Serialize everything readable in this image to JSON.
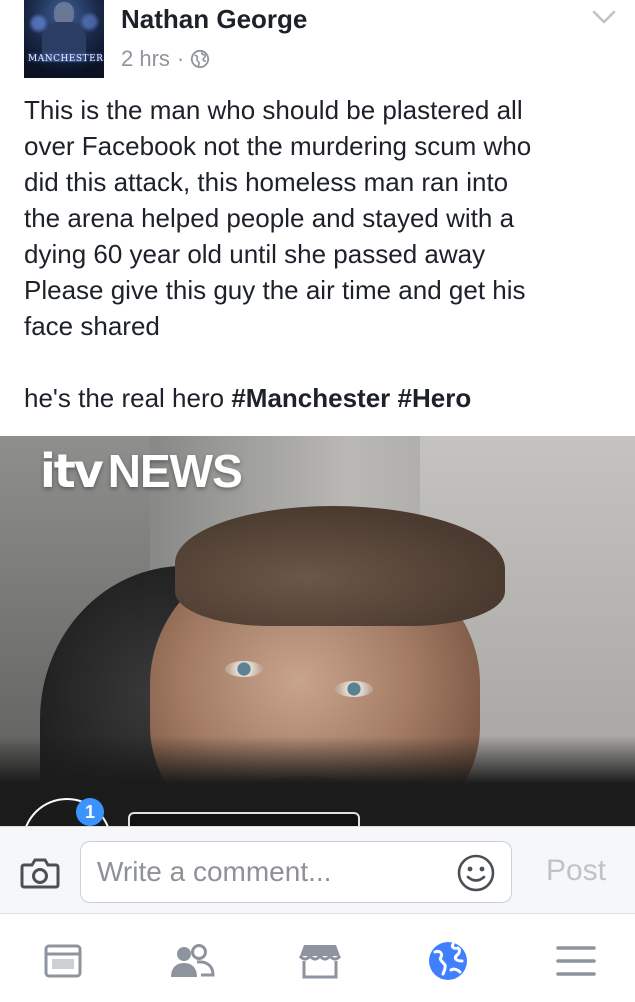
{
  "post": {
    "author": "Nathan George",
    "time": "2 hrs",
    "separator": "·",
    "avatar_caption": "MANCHESTER",
    "privacy_icon": "globe-icon",
    "menu_icon": "chevron-down-icon",
    "text_lines": [
      "This is the man who should be plastered all",
      "over Facebook not the murdering scum who",
      "did this attack, this homeless man ran into",
      "the arena helped people and stayed with a",
      "dying 60 year old until she passed away",
      "Please give this guy the air time and get his",
      "face shared"
    ],
    "closing_text": "he's the real hero",
    "hashtags": [
      "#Manchester",
      "#Hero"
    ]
  },
  "photo": {
    "logo_itv": "itv",
    "logo_news": "NEWS",
    "notification_count": "1"
  },
  "comment_bar": {
    "camera_icon": "camera-icon",
    "placeholder": "Write a comment...",
    "emoji_icon": "smiley-icon",
    "post_label": "Post",
    "post_color": "#bec3c9"
  },
  "bottom_nav": {
    "items": [
      "news-feed-icon",
      "friends-icon",
      "marketplace-icon",
      "notifications-globe-icon",
      "menu-icon"
    ],
    "active_color": "#4080ff",
    "inactive_color": "#8d949e"
  }
}
